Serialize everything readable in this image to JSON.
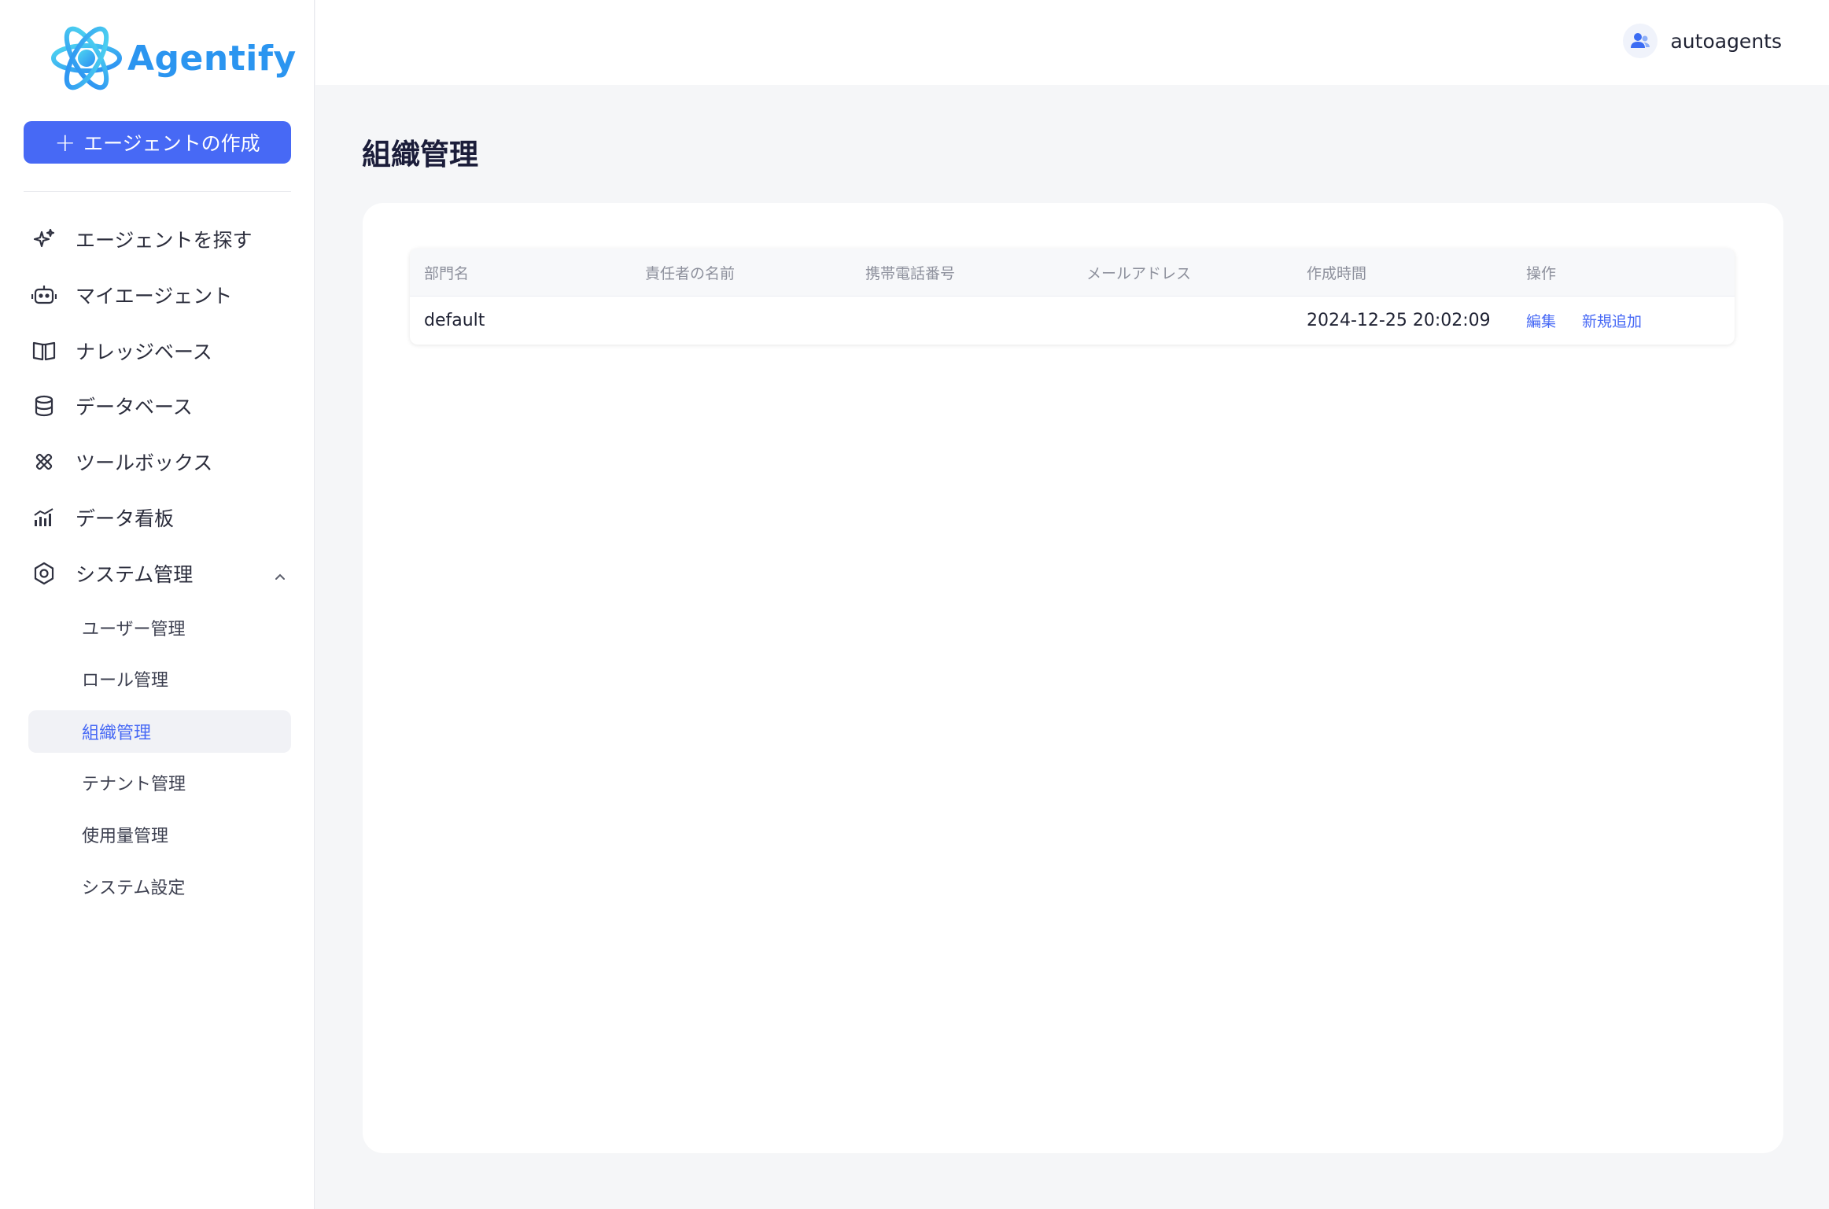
{
  "app": {
    "name": "Agentify",
    "brand_color": "#2b95f0",
    "accent_color": "#4769f5"
  },
  "sidebar": {
    "create_button": {
      "label": "エージェントの作成",
      "icon": "plus-icon"
    },
    "items": [
      {
        "label": "エージェントを探す",
        "icon": "sparkle-icon"
      },
      {
        "label": "マイエージェント",
        "icon": "robot-icon"
      },
      {
        "label": "ナレッジベース",
        "icon": "book-icon"
      },
      {
        "label": "データベース",
        "icon": "database-icon"
      },
      {
        "label": "ツールボックス",
        "icon": "tools-icon"
      },
      {
        "label": "データ看板",
        "icon": "chart-icon"
      },
      {
        "label": "システム管理",
        "icon": "settings-icon",
        "expanded": true
      }
    ],
    "sub_items": [
      {
        "label": "ユーザー管理"
      },
      {
        "label": "ロール管理"
      },
      {
        "label": "組織管理",
        "active": true
      },
      {
        "label": "テナント管理"
      },
      {
        "label": "使用量管理"
      },
      {
        "label": "システム設定"
      }
    ]
  },
  "header": {
    "user_name": "autoagents",
    "user_icon": "user-icon"
  },
  "main": {
    "title": "組織管理",
    "table": {
      "columns": [
        "部門名",
        "責任者の名前",
        "携帯電話番号",
        "メールアドレス",
        "作成時間",
        "操作"
      ],
      "rows": [
        {
          "department": "default",
          "manager": "",
          "phone": "",
          "email": "",
          "created": "2024-12-25 20:02:09",
          "actions": [
            "編集",
            "新規追加"
          ]
        }
      ]
    }
  }
}
